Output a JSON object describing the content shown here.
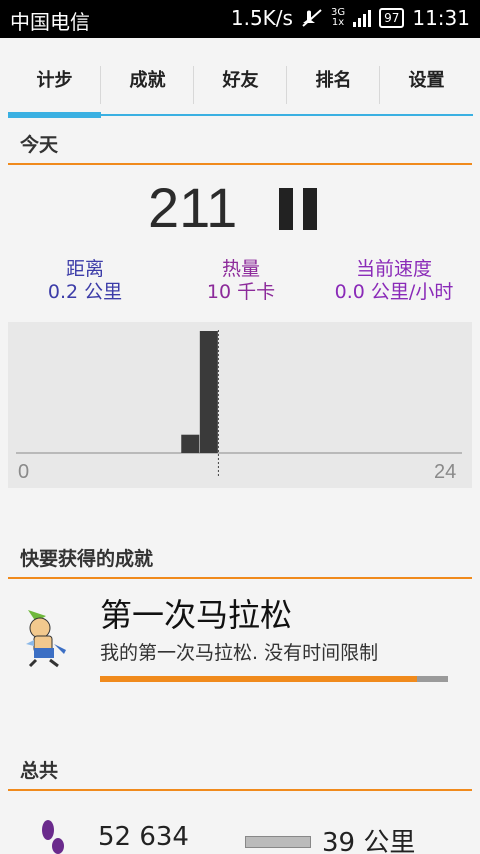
{
  "status_bar": {
    "carrier": "中国电信",
    "net_speed": "1.5K/s",
    "network_3g": "3G",
    "network_1x": "1x",
    "battery": "97",
    "time": "11:31"
  },
  "tabs": [
    {
      "label": "计步",
      "active": true
    },
    {
      "label": "成就",
      "active": false
    },
    {
      "label": "好友",
      "active": false
    },
    {
      "label": "排名",
      "active": false
    },
    {
      "label": "设置",
      "active": false
    }
  ],
  "today": {
    "section_title": "今天",
    "step_count": "211",
    "distance_label": "距离",
    "distance_value": "0.2 公里",
    "calories_label": "热量",
    "calories_value": "10 千卡",
    "speed_label": "当前速度",
    "speed_value": "0.0 公里/小时"
  },
  "chart_data": {
    "type": "bar",
    "x_start": "0",
    "x_end": "24",
    "bars": [
      {
        "hour": 9,
        "relative_height": 0.15
      },
      {
        "hour": 10,
        "relative_height": 1.0
      }
    ],
    "current_hour_marker": 11
  },
  "upcoming": {
    "section_title": "快要获得的成就",
    "achievement_title": "第一次马拉松",
    "achievement_desc": "我的第一次马拉松. 没有时间限制",
    "progress": 0.91
  },
  "totals": {
    "section_title": "总共",
    "steps": "52 634",
    "distance": "39 公里"
  },
  "colors": {
    "accent_blue": "#3ab0e2",
    "orange": "#f08a1c"
  }
}
